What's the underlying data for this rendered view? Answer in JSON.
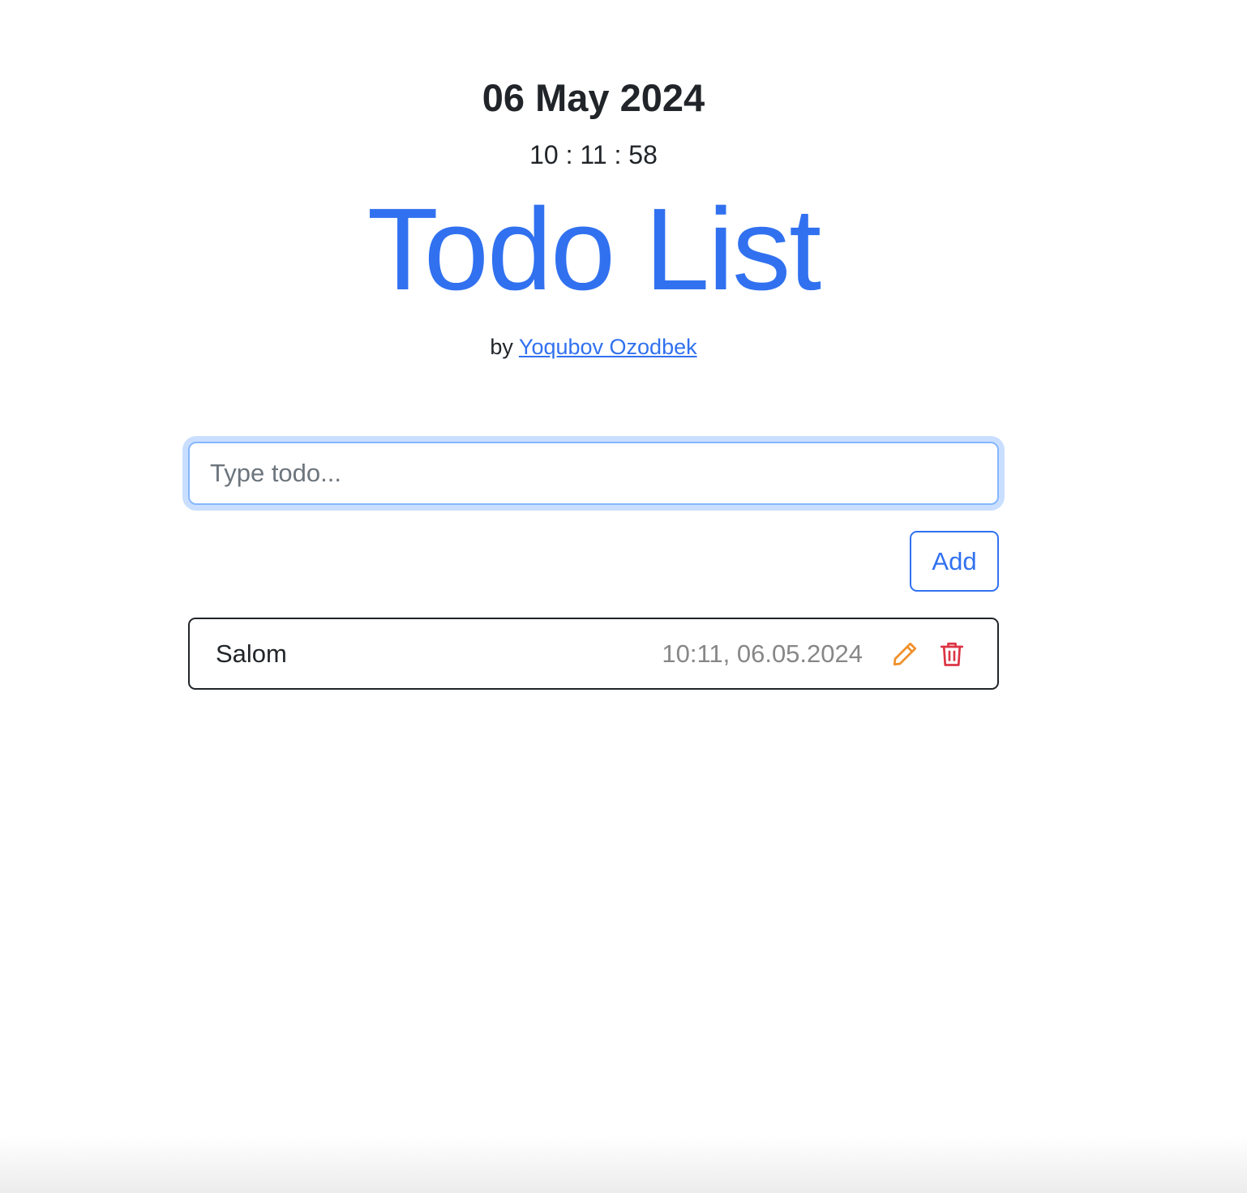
{
  "header": {
    "date": "06 May 2024",
    "clock": "10 : 11 : 58",
    "title": "Todo List",
    "by_prefix": "by",
    "author_link": "Yoqubov Ozodbek"
  },
  "form": {
    "input_placeholder": "Type todo...",
    "input_value": "",
    "add_label": "Add"
  },
  "todos": [
    {
      "text": "Salom",
      "time": "10:11, 06.05.2024",
      "edit_icon": "pencil-icon",
      "delete_icon": "trash-icon"
    }
  ],
  "colors": {
    "primary": "#3171f0",
    "warning": "#f0902a",
    "danger": "#dc3545",
    "muted": "#878787",
    "focus_border": "#86b7fe"
  }
}
